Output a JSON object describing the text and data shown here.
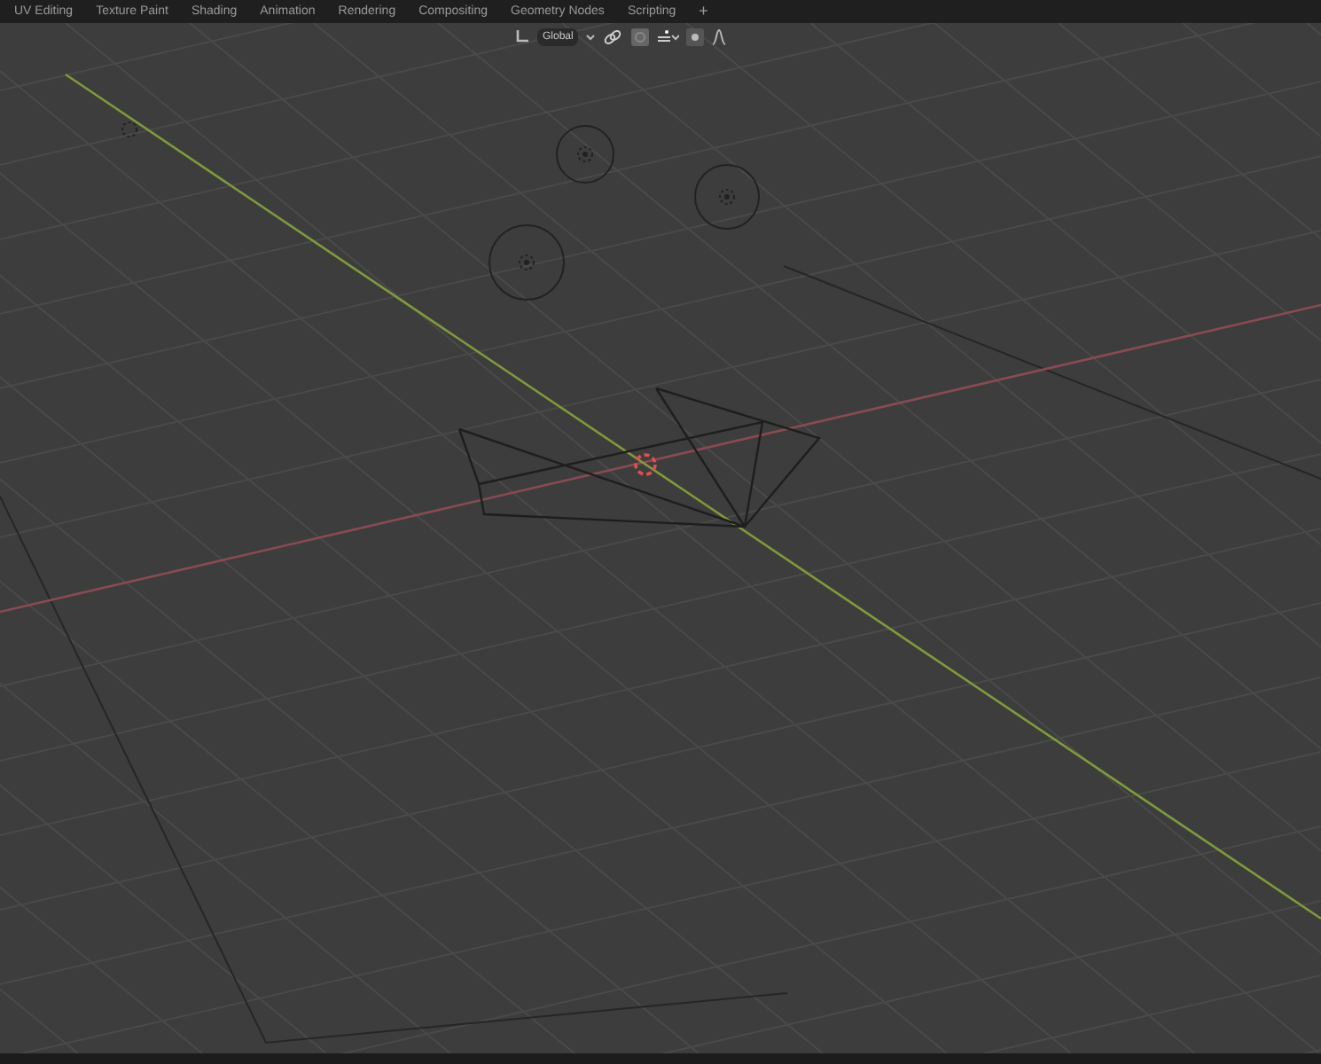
{
  "workspace_tabs": [
    {
      "label": "UV Editing",
      "selected": false
    },
    {
      "label": "Texture Paint",
      "selected": false
    },
    {
      "label": "Shading",
      "selected": false
    },
    {
      "label": "Animation",
      "selected": false
    },
    {
      "label": "Rendering",
      "selected": false
    },
    {
      "label": "Compositing",
      "selected": false
    },
    {
      "label": "Geometry Nodes",
      "selected": false
    },
    {
      "label": "Scripting",
      "selected": false
    }
  ],
  "add_tab": "+",
  "header": {
    "transform_orientation": "Global",
    "snap_on": false,
    "proportional_editing_on": false
  }
}
